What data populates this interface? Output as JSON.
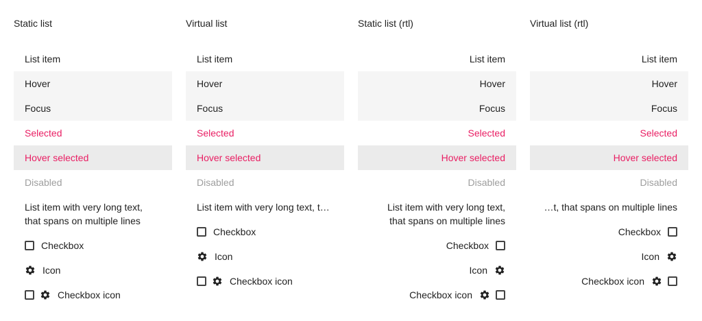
{
  "columns": [
    {
      "title": "Static list",
      "items": {
        "item": "List item",
        "hover": "Hover",
        "focus": "Focus",
        "selected": "Selected",
        "hover_selected": "Hover selected",
        "disabled": "Disabled",
        "long_text": "List item with very long text, that spans on multiple lines",
        "checkbox": "Checkbox",
        "icon": "Icon",
        "checkbox_icon": "Checkbox icon"
      }
    },
    {
      "title": "Virtual list",
      "items": {
        "item": "List item",
        "hover": "Hover",
        "focus": "Focus",
        "selected": "Selected",
        "hover_selected": "Hover selected",
        "disabled": "Disabled",
        "long_text": "List item with very long text, that spans on multiple lines",
        "checkbox": "Checkbox",
        "icon": "Icon",
        "checkbox_icon": "Checkbox icon"
      }
    },
    {
      "title": "Static list (rtl)",
      "items": {
        "item": "List item",
        "hover": "Hover",
        "focus": "Focus",
        "selected": "Selected",
        "hover_selected": "Hover selected",
        "disabled": "Disabled",
        "long_text": "List item with very long text, that spans on multiple lines",
        "checkbox": "Checkbox",
        "icon": "Icon",
        "checkbox_icon": "Checkbox icon"
      }
    },
    {
      "title": "Virtual list (rtl)",
      "items": {
        "item": "List item",
        "hover": "Hover",
        "focus": "Focus",
        "selected": "Selected",
        "hover_selected": "Hover selected",
        "disabled": "Disabled",
        "long_text": "List item with very long text, that spans on multiple lines",
        "checkbox": "Checkbox",
        "icon": "Icon",
        "checkbox_icon": "Checkbox icon"
      }
    }
  ],
  "colors": {
    "selected_text": "#e91e63",
    "hover_bg": "#f5f5f5",
    "hover_selected_bg": "#ebebeb",
    "disabled_text": "#9e9e9e"
  },
  "icons": {
    "checkbox": "checkbox-icon",
    "settings": "gear-icon"
  }
}
